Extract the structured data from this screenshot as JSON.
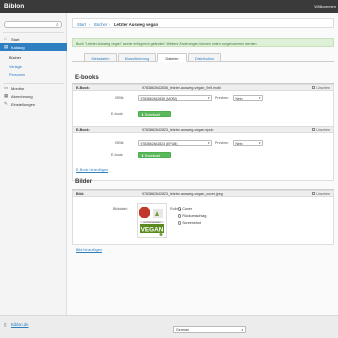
{
  "app": {
    "title": "Biblon",
    "welcome": "Willkommen"
  },
  "sidebar": {
    "search_placeholder": "",
    "items": [
      {
        "label": "Start",
        "icon": "home-icon"
      },
      {
        "label": "Katalog",
        "icon": "book-icon"
      },
      {
        "label": "Monitor",
        "icon": "monitor-icon"
      },
      {
        "label": "Abrechnung",
        "icon": "calculator-icon"
      },
      {
        "label": "Einstellungen",
        "icon": "wrench-icon"
      }
    ],
    "subitems": [
      "Bücher",
      "Verlage",
      "Personen"
    ]
  },
  "breadcrumb": {
    "start": "Start",
    "books": "Bücher",
    "current": "Letzter Ausweg vegan"
  },
  "alert": {
    "text": "Buch \"Letzter Ausweg vegan\" wurde erfolgreich geändert. Weitere Änderungen können unten vorgenommen werden."
  },
  "tabs": [
    "Metadaten",
    "Klassifizierung",
    "Dateien",
    "Distribution"
  ],
  "ebooks": {
    "heading": "E-books",
    "items": [
      {
        "type_label": "E-Book:",
        "file": "9783862642836_letzter-ausweg-vegan_9x9.mobi",
        "delete_label": "Löschen",
        "isbn_label": "ISBN:",
        "isbn": "9783862642836 (MOBI)",
        "preview_label": "Preview:",
        "preview_value": "Nein",
        "ebook_label": "E-book:",
        "download_label": "Download"
      },
      {
        "type_label": "E-Book:",
        "file": "9783862642823_letzter-ausweg-vegan.epub",
        "delete_label": "Löschen",
        "isbn_label": "ISBN:",
        "isbn": "9783862642823 (EPUB)",
        "preview_label": "Preview:",
        "preview_value": "Nein",
        "ebook_label": "E-book:",
        "download_label": "Download"
      }
    ],
    "add_link": "E-Book hinzufügen"
  },
  "images": {
    "heading": "Bilder",
    "item": {
      "type_label": "Bild:",
      "file": "9783862642823_letzter-ausweg-vegan_cover.jpeg",
      "delete_label": "Löschen",
      "image_label": "Bilddatei:",
      "role_label": "Rolle:",
      "roles": [
        "Cover",
        "Rückumschlag",
        "Screenshot"
      ],
      "selected_role": "Cover",
      "cover_text_top": "LETZTER AUSWEG",
      "cover_text_main": "VEGAN"
    },
    "add_link": "Bild hinzufügen"
  },
  "footer": {
    "link": "Biblon.de",
    "language": "German"
  },
  "colors": {
    "accent": "#2e7fc1",
    "topbar": "#3a3a3a",
    "success": "#5cb85c",
    "alert_bg": "#dff0d8"
  }
}
